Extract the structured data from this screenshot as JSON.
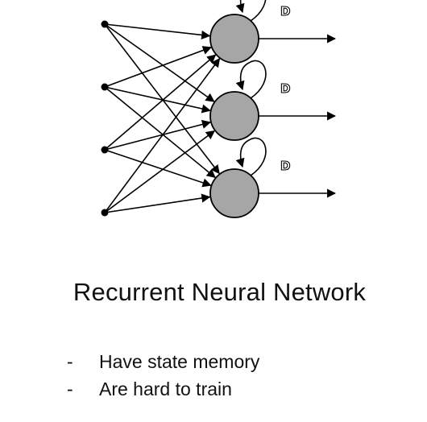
{
  "diagram": {
    "delay_label": "D",
    "input_count": 4,
    "neuron_count": 3,
    "colors": {
      "neuron_fill": "#a6a6a6",
      "stroke": "#000000"
    }
  },
  "title": "Recurrent Neural Network",
  "bullets": [
    {
      "marker": "-",
      "text": "Have state memory"
    },
    {
      "marker": "-",
      "text": "Are hard to train"
    }
  ]
}
